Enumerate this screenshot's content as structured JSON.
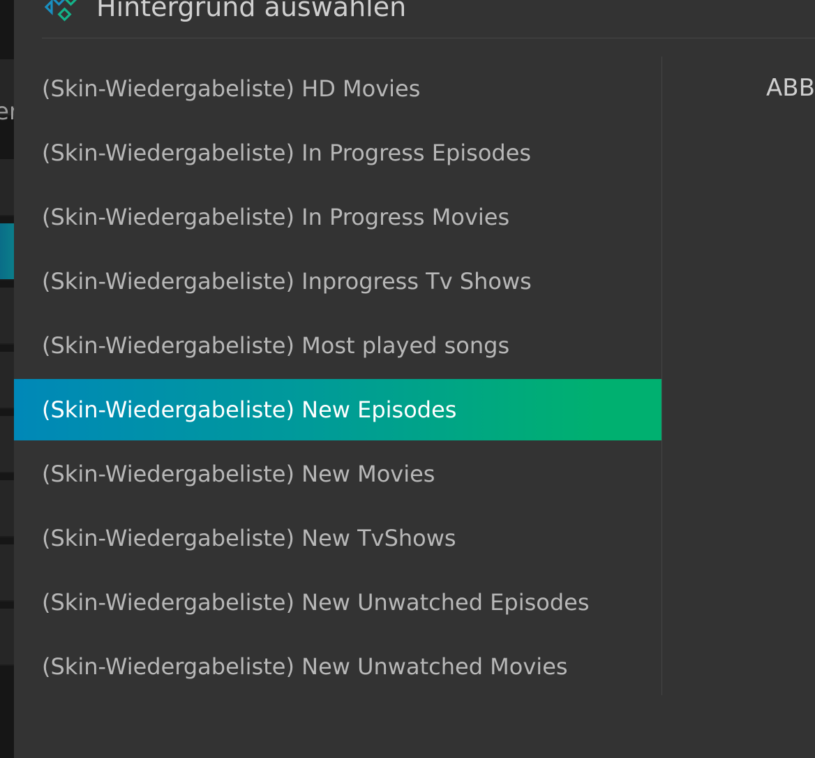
{
  "background": {
    "partial_text": "er"
  },
  "dialog": {
    "title": "Hintergrund auswählen",
    "items": [
      {
        "label": "(Skin-Wiedergabeliste) HD Movies",
        "selected": false
      },
      {
        "label": "(Skin-Wiedergabeliste) In Progress Episodes",
        "selected": false
      },
      {
        "label": "(Skin-Wiedergabeliste) In Progress Movies",
        "selected": false
      },
      {
        "label": "(Skin-Wiedergabeliste) Inprogress Tv Shows",
        "selected": false
      },
      {
        "label": "(Skin-Wiedergabeliste) Most played songs",
        "selected": false
      },
      {
        "label": "(Skin-Wiedergabeliste) New Episodes",
        "selected": true
      },
      {
        "label": "(Skin-Wiedergabeliste) New Movies",
        "selected": false
      },
      {
        "label": "(Skin-Wiedergabeliste) New TvShows",
        "selected": false
      },
      {
        "label": "(Skin-Wiedergabeliste) New Unwatched Episodes",
        "selected": false
      },
      {
        "label": "(Skin-Wiedergabeliste) New Unwatched Movies",
        "selected": false
      }
    ],
    "side_button_label": "ABBRECHEN"
  },
  "colors": {
    "dialog_bg": "#333333",
    "selection_start": "#0088b8",
    "selection_end": "#00b070",
    "logo_blue": "#1a8fc0",
    "logo_green": "#14b38a"
  },
  "icons": {
    "logo": "kodi-logo-icon"
  }
}
